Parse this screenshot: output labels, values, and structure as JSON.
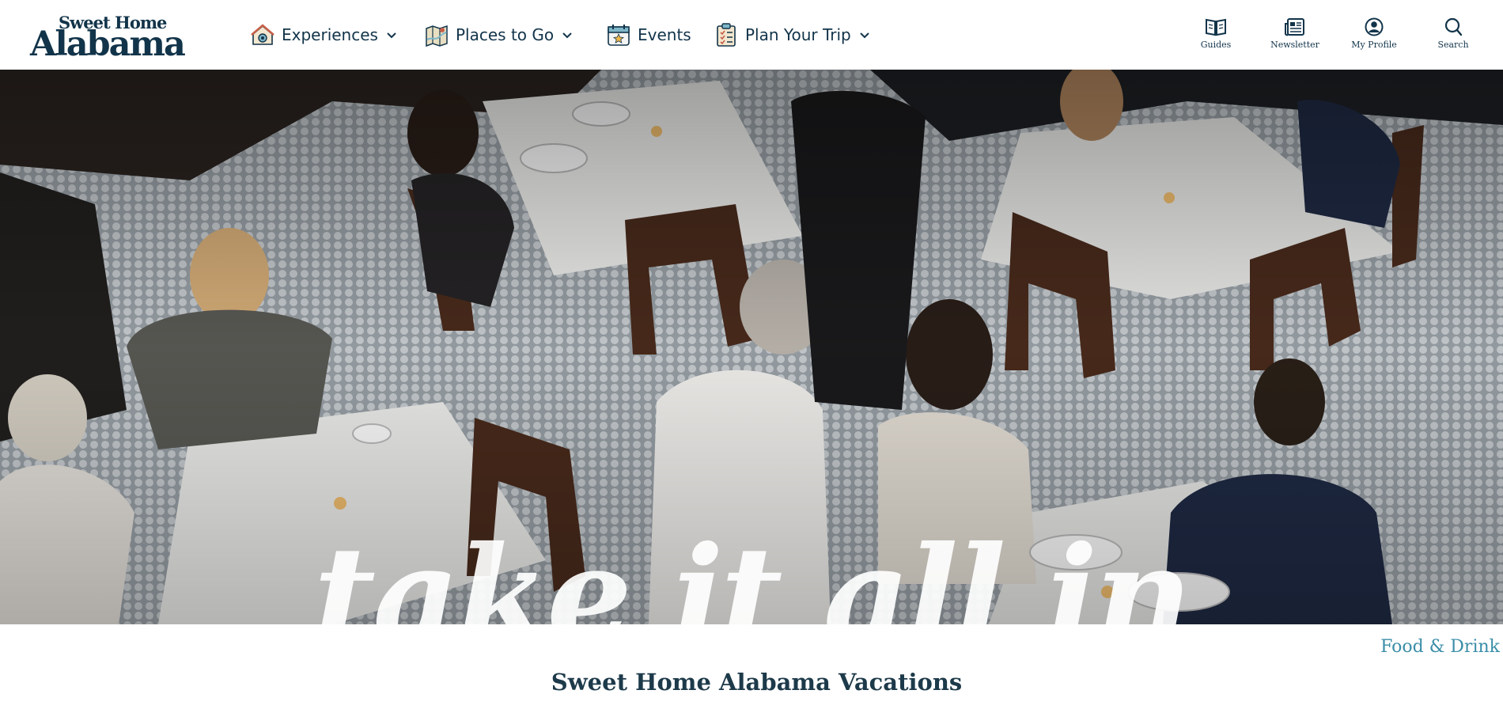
{
  "brand": {
    "line1": "Sweet Home",
    "line2": "Alabama"
  },
  "nav": [
    {
      "label": "Experiences",
      "icon": "house-icon",
      "dropdown": true
    },
    {
      "label": "Places to Go",
      "icon": "map-icon",
      "dropdown": true
    },
    {
      "label": "Events",
      "icon": "calendar-icon",
      "dropdown": false
    },
    {
      "label": "Plan Your Trip",
      "icon": "checklist-icon",
      "dropdown": true
    }
  ],
  "utility": [
    {
      "label": "Guides",
      "icon": "book-icon"
    },
    {
      "label": "Newsletter",
      "icon": "newspaper-icon"
    },
    {
      "label": "My Profile",
      "icon": "profile-icon"
    },
    {
      "label": "Search",
      "icon": "search-icon"
    }
  ],
  "hero": {
    "headline": "take it all in",
    "category": "Food & Drink"
  },
  "heading": "Sweet Home Alabama Vacations",
  "colors": {
    "brand_navy": "#12344a",
    "link_teal": "#3a8ea8",
    "heading": "#1d3a4a",
    "icon_accent": "#7fb7c9"
  }
}
